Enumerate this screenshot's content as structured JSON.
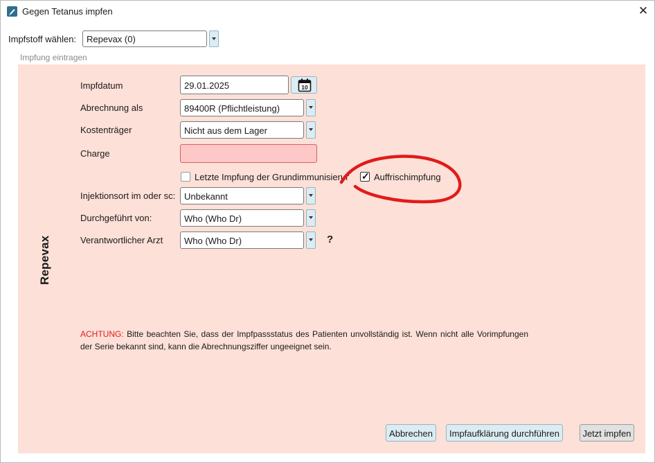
{
  "window": {
    "title": "Gegen Tetanus impfen",
    "close_glyph": "✕"
  },
  "vaccine": {
    "label": "Impfstoff wählen:",
    "value": "Repevax (0)"
  },
  "group": {
    "caption": "Impfung eintragen",
    "side_label": "Repevax"
  },
  "form": {
    "date": {
      "label": "Impfdatum",
      "value": "29.01.2025",
      "calendar_day": "10"
    },
    "billing": {
      "label": "Abrechnung als",
      "value": "89400R (Pflichtleistung)"
    },
    "payer": {
      "label": "Kostenträger",
      "value": "Nicht aus dem Lager"
    },
    "charge": {
      "label": "Charge",
      "value": ""
    },
    "checkboxes": {
      "last_basic": {
        "label": "Letzte Impfung der Grundimmunisierung",
        "checked": false
      },
      "booster": {
        "label": "Auffrischimpfung",
        "checked": true
      }
    },
    "site": {
      "label": "Injektionsort im oder sc:",
      "value": "Unbekannt"
    },
    "performed_by": {
      "label": "Durchgeführt von:",
      "value": "Who (Who Dr)"
    },
    "doctor": {
      "label": "Verantwortlicher Arzt",
      "value": "Who (Who Dr)"
    },
    "help_glyph": "?"
  },
  "warning": {
    "heading": "ACHTUNG:",
    "text": "Bitte beachten Sie, dass der Impfpassstatus des Patienten unvollständig ist. Wenn nicht alle Vorimpfungen der Serie bekannt sind, kann die Abrechnungsziffer ungeeignet sein."
  },
  "buttons": {
    "cancel": "Abbrechen",
    "education": "Impfaufklärung durchführen",
    "vaccinate": "Jetzt impfen"
  },
  "colors": {
    "panel": "#fde0d7",
    "warning": "#e01b1b",
    "annotation": "#e01b1b",
    "charge_field": "#ffc8c8"
  }
}
